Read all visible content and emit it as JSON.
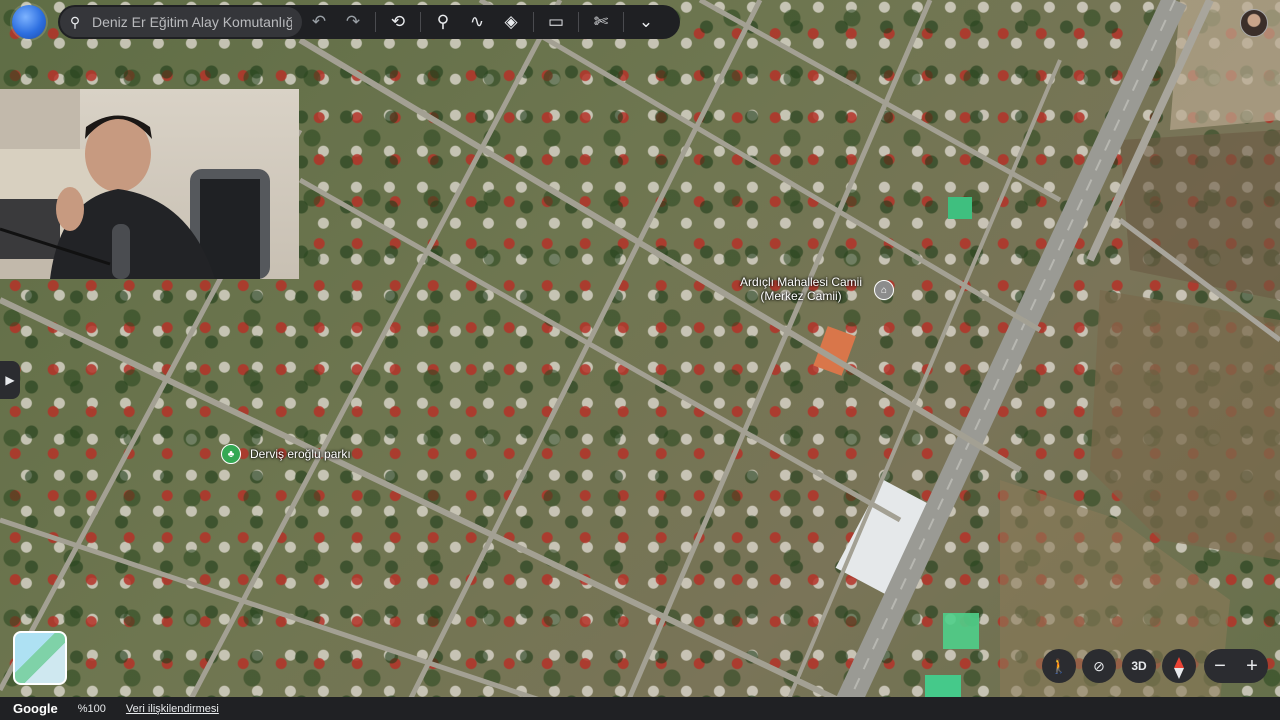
{
  "search": {
    "placeholder": "Deniz Er Eğitim Alay Komutanlığı"
  },
  "toolbar": {
    "icons": [
      "search-icon",
      "undo-icon",
      "redo-icon",
      "history-icon",
      "place-pin-icon",
      "path-icon",
      "layers-icon",
      "ruler-icon",
      "satellite-tool-icon",
      "chevron-down-icon"
    ]
  },
  "places": [
    {
      "name": "Ardıçlı Mahallesi Camii (Merkez Camii)",
      "kind": "mosque"
    },
    {
      "name": "Derviş eroğlu parkı",
      "kind": "park"
    }
  ],
  "controls": {
    "three_d_label": "3D",
    "zoom_out": "−",
    "zoom_in": "+"
  },
  "status_bar": {
    "brand": "Google",
    "zoom_level": "%100",
    "data_link": "Veri ilişkilendirmesi"
  },
  "colors": {
    "toolbar_bg": "#1f2023",
    "park_green": "#34a853",
    "compass_red": "#ea4335"
  }
}
